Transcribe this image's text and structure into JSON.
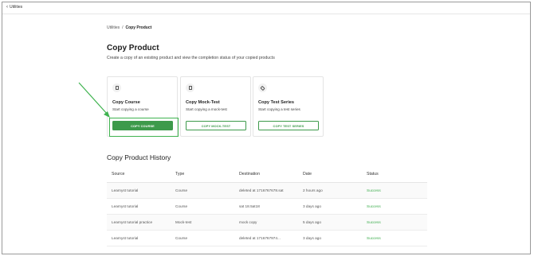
{
  "topbar": {
    "back_label": "Utilities"
  },
  "breadcrumb": {
    "parent": "Utilities",
    "separator": "/",
    "current": "Copy Product"
  },
  "page": {
    "title": "Copy Product",
    "subtitle": "Create a copy of an existing product and view the completion status of your copied products"
  },
  "cards": [
    {
      "title": "Copy Course",
      "subtitle": "Start copying a course",
      "button": "COPY COURSE",
      "icon": "book-icon"
    },
    {
      "title": "Copy Mock-Test",
      "subtitle": "Start copying a mock-test",
      "button": "COPY MOCK-TEST",
      "icon": "clipboard-icon"
    },
    {
      "title": "Copy Test Series",
      "subtitle": "Start copying a test series",
      "button": "COPY TEST SERIES",
      "icon": "layers-icon"
    }
  ],
  "history": {
    "title": "Copy Product History",
    "columns": [
      "Source",
      "Type",
      "Destination",
      "Date",
      "Status"
    ],
    "rows": [
      [
        "Learnyst tutorial",
        "Course",
        "deleted at 1716767678.sat",
        "2 hours ago",
        "Success"
      ],
      [
        "Learnyst tutorial",
        "Course",
        "sat 18.5at18",
        "3 days ago",
        "Success"
      ],
      [
        "Learnyst tutorial practice",
        "Mock-test",
        "mock copy",
        "5 days ago",
        "Success"
      ],
      [
        "Learnyst tutorial",
        "Course",
        "deleted at 1716767974...",
        "3 days ago",
        "Success"
      ]
    ]
  },
  "colors": {
    "accent": "#3d9a4b",
    "success": "#3fae4f",
    "annotation": "#3fb34f"
  }
}
